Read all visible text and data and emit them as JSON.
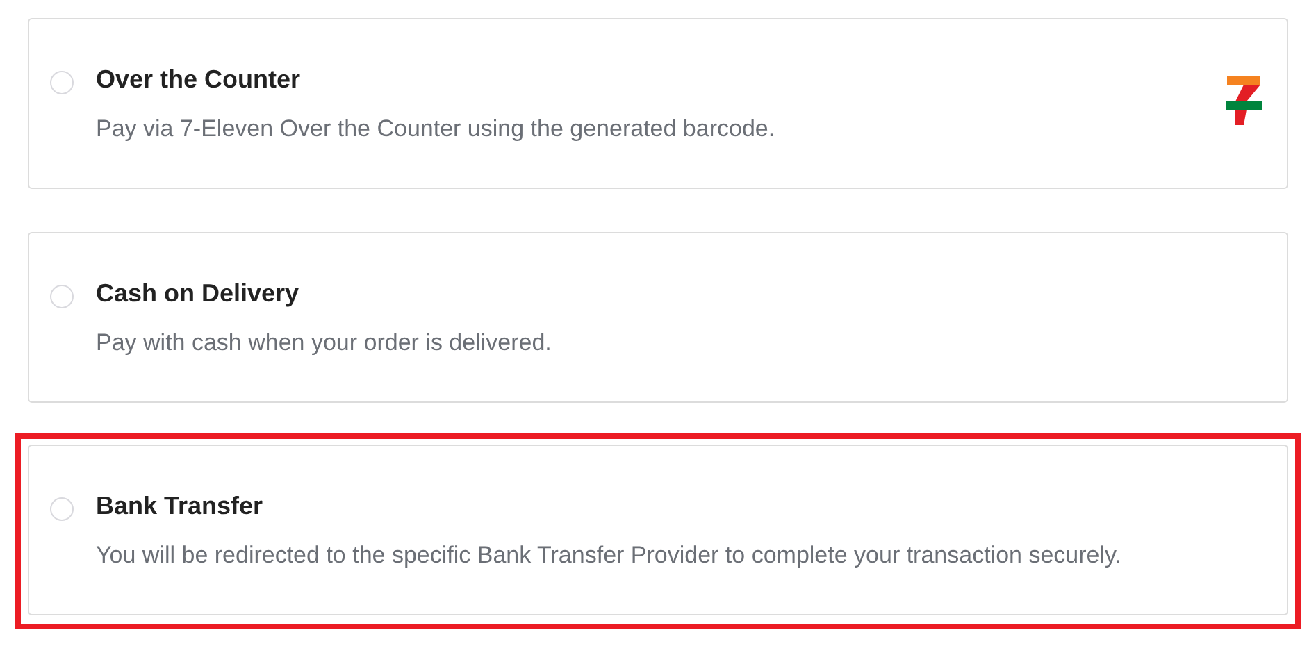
{
  "payment_options": [
    {
      "title": "Over the Counter",
      "description": "Pay via 7-Eleven Over the Counter using the generated barcode.",
      "selected": false,
      "highlighted": false,
      "has_logo": true
    },
    {
      "title": "Cash on Delivery",
      "description": "Pay with cash when your order is delivered.",
      "selected": false,
      "highlighted": false,
      "has_logo": false
    },
    {
      "title": "Bank Transfer",
      "description": "You will be redirected to the specific Bank Transfer Provider to complete your transaction securely.",
      "selected": false,
      "highlighted": true,
      "has_logo": false
    }
  ]
}
